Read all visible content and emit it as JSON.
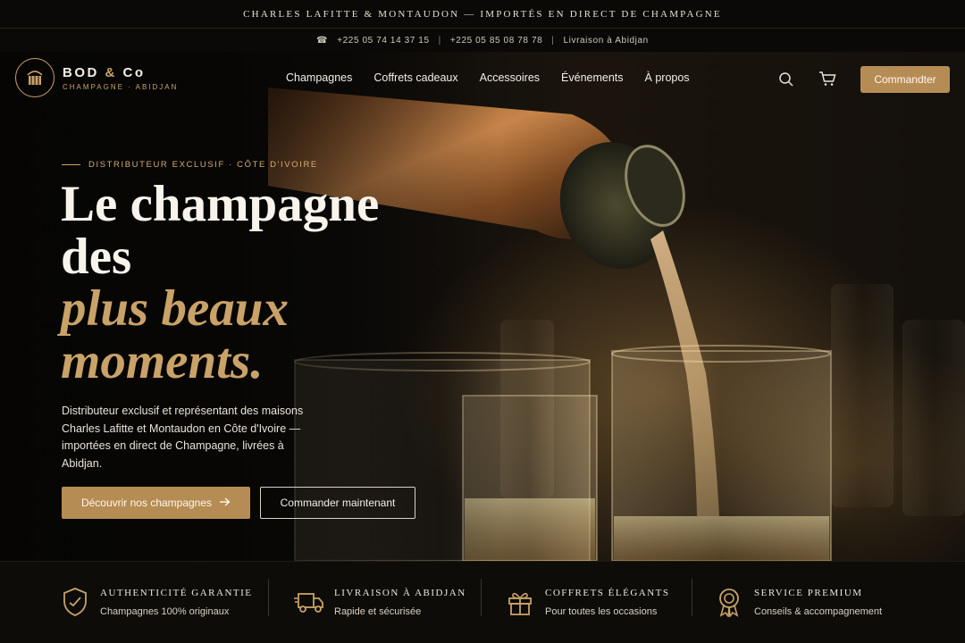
{
  "announcement": "CHARLES LAFITTE & MONTAUDON — IMPORTÉS EN DIRECT DE CHAMPAGNE",
  "contact": {
    "phone1": "+225 05 74 14 37 15",
    "phone2": "+225 05 85 08 78 78",
    "delivery": "Livraison à Abidjan",
    "separator": "|"
  },
  "logo": {
    "brand_a": "BOD",
    "brand_amp": "&",
    "brand_b": "Co",
    "subtitle": "CHAMPAGNE · ABIDJAN"
  },
  "nav": [
    "Champagnes",
    "Coffrets cadeaux",
    "Accessoires",
    "Événements",
    "À propos"
  ],
  "header": {
    "order_label": "Commandter"
  },
  "hero": {
    "eyebrow": "DISTRIBUTEUR EXCLUSIF · CÔTE D'IVOIRE",
    "headline_1": "Le champagne",
    "headline_2": "des",
    "headline_3": "plus beaux",
    "headline_4": "moments.",
    "lead": "Distributeur exclusif et représentant des maisons Charles Lafitte et Montaudon en Côte d'Ivoire — importées en direct de Champagne, livrées à Abidjan.",
    "cta_primary": "Découvrir nos champagnes",
    "cta_secondary": "Commander maintenant"
  },
  "features": [
    {
      "title": "AUTHENTICITÉ GARANTIE",
      "subtitle": "Champagnes 100% originaux",
      "icon": "shield-check-icon"
    },
    {
      "title": "LIVRAISON À ABIDJAN",
      "subtitle": "Rapide et sécurisée",
      "icon": "delivery-truck-icon"
    },
    {
      "title": "COFFRETS ÉLÉGANTS",
      "subtitle": "Pour toutes les occasions",
      "icon": "gift-icon"
    },
    {
      "title": "SERVICE PREMIUM",
      "subtitle": "Conseils & accompagnement",
      "icon": "award-medal-icon"
    }
  ],
  "colors": {
    "gold": "#c9a268",
    "button_gold": "#b68c55",
    "background": "#0b0a08"
  }
}
